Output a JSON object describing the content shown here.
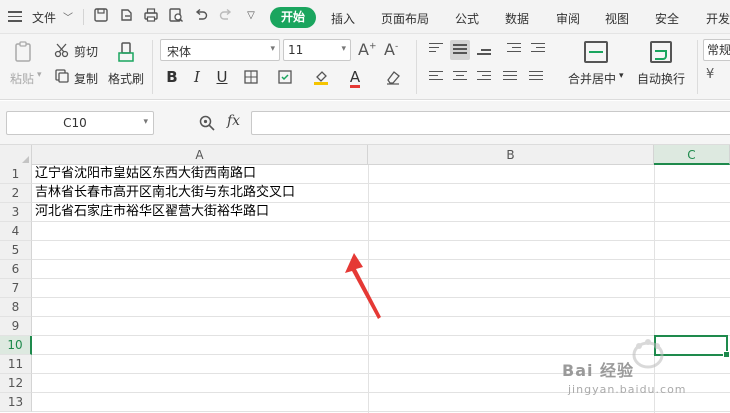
{
  "menubar": {
    "file": "文件",
    "start": "开始",
    "tabs": [
      "插入",
      "页面布局",
      "公式",
      "数据",
      "审阅",
      "视图",
      "安全",
      "开发"
    ]
  },
  "ribbon": {
    "paste": "粘贴",
    "cut": "剪切",
    "copy": "复制",
    "format_painter": "格式刷",
    "font_name": "宋体",
    "font_size": "11",
    "merge_center": "合并居中",
    "auto_wrap": "自动换行",
    "number_format": "常规"
  },
  "formula_bar": {
    "name_box": "C10",
    "fx": "fx",
    "formula": ""
  },
  "sheet": {
    "columns": [
      "A",
      "B",
      "C"
    ],
    "selected_column": "C",
    "rows": [
      "1",
      "2",
      "3",
      "4",
      "5",
      "6",
      "7",
      "8",
      "9",
      "10",
      "11",
      "12",
      "13"
    ],
    "selected_row": "10",
    "cells_A": [
      "辽宁省沈阳市皇姑区东西大街西南路口",
      "吉林省长春市高开区南北大街与东北路交叉口",
      "河北省石家庄市裕华区翟营大街裕华路口"
    ],
    "active_cell": "C10"
  },
  "watermark": {
    "text": "Bai 经验",
    "sub": "jingyan.baidu.com"
  },
  "colors": {
    "accent": "#1aa55e",
    "selection": "#1e8a4c",
    "arrow": "#e53935"
  }
}
